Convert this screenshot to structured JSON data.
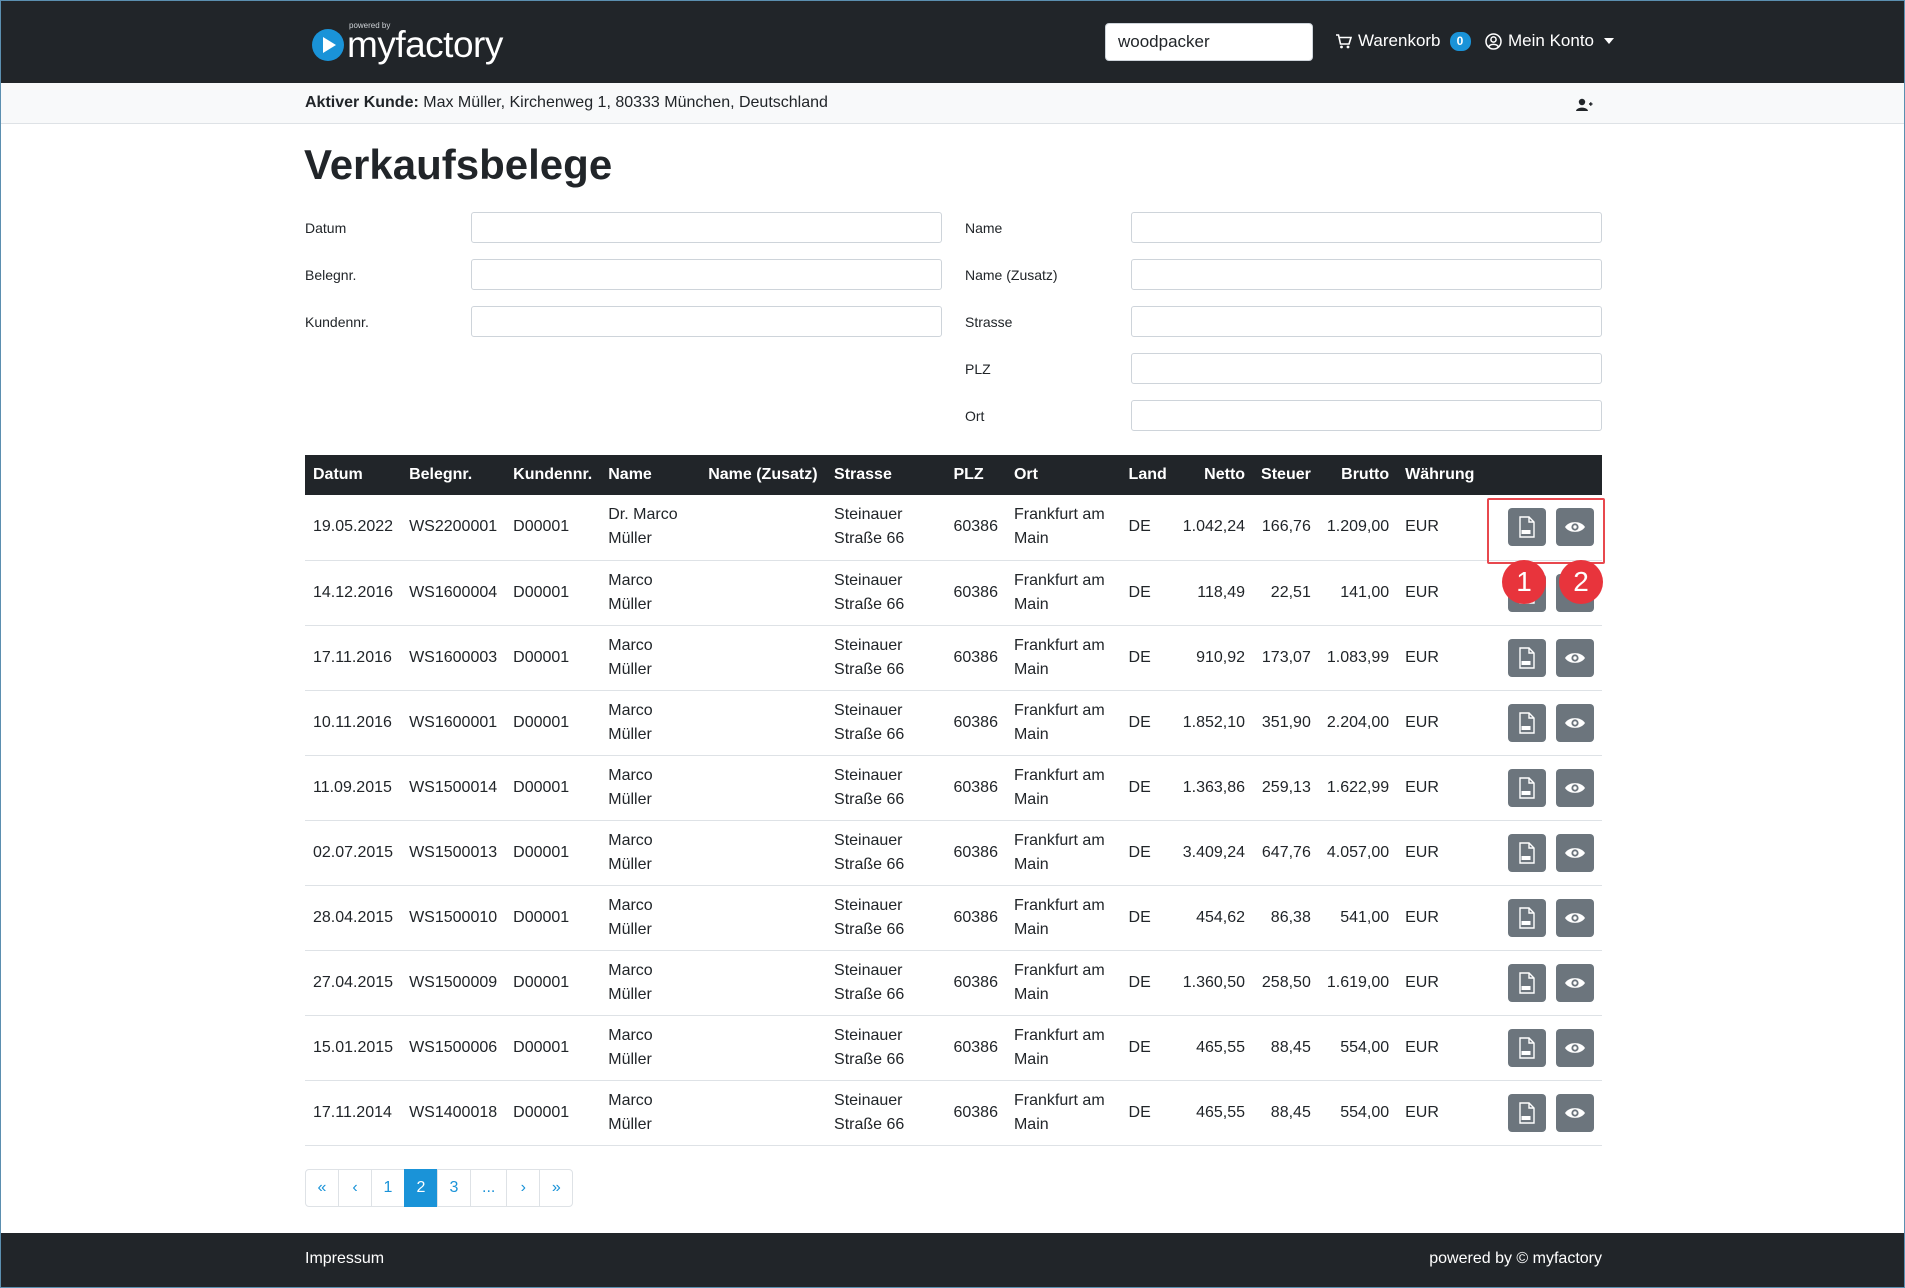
{
  "brand": {
    "powered_by": "powered by",
    "name": "myfactory"
  },
  "header": {
    "search_value": "woodpacker",
    "cart_label": "Warenkorb",
    "cart_count": "0",
    "account_label": "Mein Konto"
  },
  "customer": {
    "label": "Aktiver Kunde:",
    "value": "Max Müller, Kirchenweg 1, 80333 München, Deutschland"
  },
  "page_title": "Verkaufsbelege",
  "filters": {
    "datum": "Datum",
    "belegnr": "Belegnr.",
    "kundennr": "Kundennr.",
    "name": "Name",
    "name_zusatz": "Name (Zusatz)",
    "strasse": "Strasse",
    "plz": "PLZ",
    "ort": "Ort"
  },
  "table": {
    "headers": [
      "Datum",
      "Belegnr.",
      "Kundennr.",
      "Name",
      "Name (Zusatz)",
      "Strasse",
      "PLZ",
      "Ort",
      "Land",
      "Netto",
      "Steuer",
      "Brutto",
      "Währung"
    ],
    "rows": [
      [
        "19.05.2022",
        "WS2200001",
        "D00001",
        "Dr. Marco Müller",
        "",
        "Steinauer Straße 66",
        "60386",
        "Frankfurt am Main",
        "DE",
        "1.042,24",
        "166,76",
        "1.209,00",
        "EUR"
      ],
      [
        "14.12.2016",
        "WS1600004",
        "D00001",
        "Marco Müller",
        "",
        "Steinauer Straße 66",
        "60386",
        "Frankfurt am Main",
        "DE",
        "118,49",
        "22,51",
        "141,00",
        "EUR"
      ],
      [
        "17.11.2016",
        "WS1600003",
        "D00001",
        "Marco Müller",
        "",
        "Steinauer Straße 66",
        "60386",
        "Frankfurt am Main",
        "DE",
        "910,92",
        "173,07",
        "1.083,99",
        "EUR"
      ],
      [
        "10.11.2016",
        "WS1600001",
        "D00001",
        "Marco Müller",
        "",
        "Steinauer Straße 66",
        "60386",
        "Frankfurt am Main",
        "DE",
        "1.852,10",
        "351,90",
        "2.204,00",
        "EUR"
      ],
      [
        "11.09.2015",
        "WS1500014",
        "D00001",
        "Marco Müller",
        "",
        "Steinauer Straße 66",
        "60386",
        "Frankfurt am Main",
        "DE",
        "1.363,86",
        "259,13",
        "1.622,99",
        "EUR"
      ],
      [
        "02.07.2015",
        "WS1500013",
        "D00001",
        "Marco Müller",
        "",
        "Steinauer Straße 66",
        "60386",
        "Frankfurt am Main",
        "DE",
        "3.409,24",
        "647,76",
        "4.057,00",
        "EUR"
      ],
      [
        "28.04.2015",
        "WS1500010",
        "D00001",
        "Marco Müller",
        "",
        "Steinauer Straße 66",
        "60386",
        "Frankfurt am Main",
        "DE",
        "454,62",
        "86,38",
        "541,00",
        "EUR"
      ],
      [
        "27.04.2015",
        "WS1500009",
        "D00001",
        "Marco Müller",
        "",
        "Steinauer Straße 66",
        "60386",
        "Frankfurt am Main",
        "DE",
        "1.360,50",
        "258,50",
        "1.619,00",
        "EUR"
      ],
      [
        "15.01.2015",
        "WS1500006",
        "D00001",
        "Marco Müller",
        "",
        "Steinauer Straße 66",
        "60386",
        "Frankfurt am Main",
        "DE",
        "465,55",
        "88,45",
        "554,00",
        "EUR"
      ],
      [
        "17.11.2014",
        "WS1400018",
        "D00001",
        "Marco Müller",
        "",
        "Steinauer Straße 66",
        "60386",
        "Frankfurt am Main",
        "DE",
        "465,55",
        "88,45",
        "554,00",
        "EUR"
      ]
    ],
    "row_actions": [
      "pdf-icon",
      "eye-icon"
    ]
  },
  "annotations": {
    "marker_1": "1",
    "marker_2": "2"
  },
  "pagination": {
    "first": "«",
    "prev": "‹",
    "pages": [
      "1",
      "2",
      "3",
      "..."
    ],
    "active": "2",
    "next": "›",
    "last": "»"
  },
  "footer": {
    "left": "Impressum",
    "right": "powered by © myfactory"
  },
  "colors": {
    "topbar": "#212529",
    "accent": "#1a93d8",
    "button": "#6c757d",
    "marker": "#e8343c"
  }
}
